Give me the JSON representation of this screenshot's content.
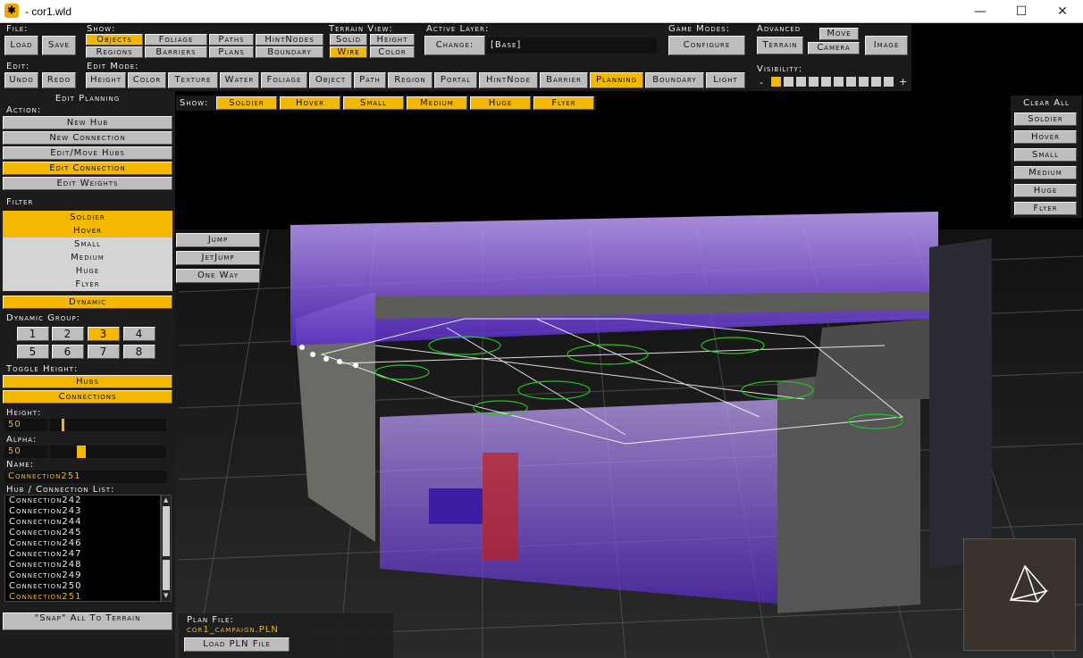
{
  "window": {
    "title": "- cor1.wld",
    "app_icon": "game-engine-icon",
    "minimize_icon": "minimize-icon",
    "maximize_icon": "maximize-icon",
    "close_icon": "close-icon"
  },
  "toolbar": {
    "file_label": "File:",
    "load": "Load",
    "save": "Save",
    "show_label": "Show:",
    "show_items": [
      "Objects",
      "Foliage",
      "Paths",
      "HintNodes",
      "Regions",
      "Barriers",
      "Plans",
      "Boundary"
    ],
    "terrain_view_label": "Terrain View:",
    "terrain_view_items": [
      "Solid",
      "Height",
      "Wire",
      "Color"
    ],
    "active_layer_label": "Active Layer:",
    "change_label": "Change:",
    "layer_value": "[Base]",
    "game_modes_label": "Game Modes:",
    "configure": "Configure",
    "advanced_label": "Advanced",
    "move": "Move",
    "terrain": "Terrain",
    "camera": "Camera",
    "image": "Image",
    "edit_label": "Edit:",
    "undo": "Undo",
    "redo": "Redo",
    "edit_mode_label": "Edit Mode:",
    "edit_modes": [
      "Height",
      "Color",
      "Texture",
      "Water",
      "Foliage",
      "Object",
      "Path",
      "Region",
      "Portal",
      "HintNode",
      "Barrier",
      "Planning",
      "Boundary",
      "Light"
    ],
    "visibility_label": "Visibility:",
    "vis_minus": "-",
    "vis_plus": "+"
  },
  "planning": {
    "title": "Edit Planning",
    "action_label": "Action:",
    "actions": [
      "New Hub",
      "New Connection",
      "Edit/Move Hubs",
      "Edit Connection",
      "Edit Weights"
    ],
    "filter_label": "Filter",
    "filters": [
      "Soldier",
      "Hover",
      "Small",
      "Medium",
      "Huge",
      "Flyer"
    ],
    "dynamic": "Dynamic",
    "dynamic_group_label": "Dynamic Group:",
    "groups": [
      "1",
      "2",
      "3",
      "4",
      "5",
      "6",
      "7",
      "8"
    ],
    "toggle_height_label": "Toggle Height:",
    "hubs": "Hubs",
    "connections": "Connections",
    "height_label": "Height:",
    "height_value": "50",
    "height_level": 0.1,
    "alpha_label": "Alpha:",
    "alpha_value": "50",
    "alpha_level": 0.25,
    "name_label": "Name:",
    "name_value": "Connection251",
    "list_label": "Hub / Connection List:",
    "list_items": [
      "Connection242",
      "Connection243",
      "Connection244",
      "Connection245",
      "Connection246",
      "Connection247",
      "Connection248",
      "Connection249",
      "Connection250",
      "Connection251"
    ],
    "snap": "\"Snap\" All To Terrain",
    "connection_types": [
      "Jump",
      "JetJump",
      "One Way"
    ]
  },
  "show_bar": {
    "label": "Show:",
    "items": [
      "Soldier",
      "Hover",
      "Small",
      "Medium",
      "Huge",
      "Flyer"
    ]
  },
  "right_panel": {
    "clear_all": "Clear All",
    "items": [
      "Soldier",
      "Hover",
      "Small",
      "Medium",
      "Huge",
      "Flyer"
    ]
  },
  "plan_file": {
    "label": "Plan File:",
    "value": "cor1_campaign.PLN",
    "load_button": "Load PLN File"
  },
  "colors": {
    "accent": "#f5b800",
    "panel": "#1a1a1a",
    "button": "#bdbdbd"
  }
}
